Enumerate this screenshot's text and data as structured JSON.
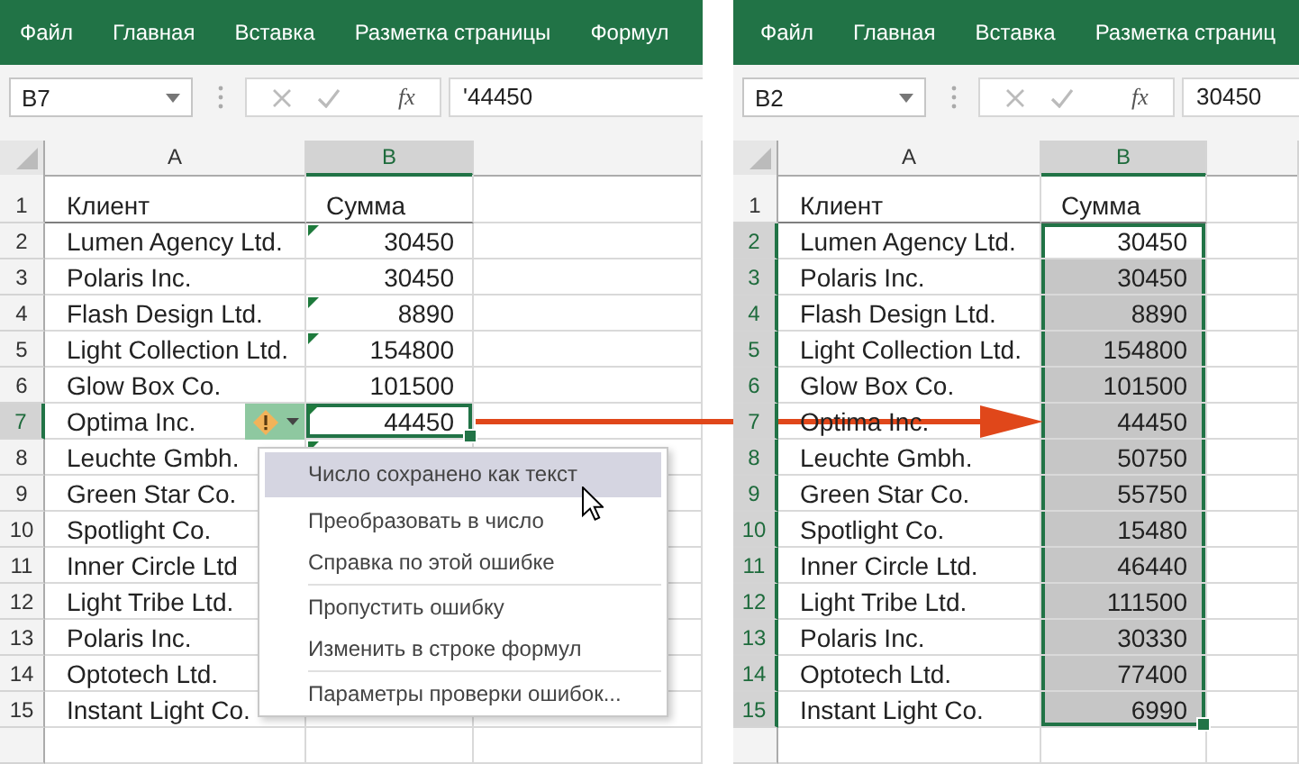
{
  "panels": [
    {
      "ribbon_tabs": [
        "Файл",
        "Главная",
        "Вставка",
        "Разметка страницы",
        "Формул"
      ],
      "name_box": "B7",
      "formula_button": "fx",
      "formula": "'44450",
      "columns": [
        {
          "label": "A",
          "selected": false
        },
        {
          "label": "B",
          "selected": true
        }
      ],
      "rows": [
        {
          "number": "1",
          "kind": "heading",
          "client": "Клиент",
          "amount": "Сумма",
          "header_selected": false,
          "amount_selected": false,
          "active": false,
          "error_mark": false,
          "error_button": false
        },
        {
          "number": "2",
          "kind": "data",
          "client": "Lumen Agency Ltd.",
          "amount": "30450",
          "header_selected": false,
          "amount_selected": false,
          "active": false,
          "error_mark": true,
          "error_button": false
        },
        {
          "number": "3",
          "kind": "data",
          "client": "Polaris Inc.",
          "amount": "30450",
          "header_selected": false,
          "amount_selected": false,
          "active": false,
          "error_mark": false,
          "error_button": false
        },
        {
          "number": "4",
          "kind": "data",
          "client": "Flash Design Ltd.",
          "amount": "8890",
          "header_selected": false,
          "amount_selected": false,
          "active": false,
          "error_mark": true,
          "error_button": false
        },
        {
          "number": "5",
          "kind": "data",
          "client": "Light Collection Ltd.",
          "amount": "154800",
          "header_selected": false,
          "amount_selected": false,
          "active": false,
          "error_mark": true,
          "error_button": false
        },
        {
          "number": "6",
          "kind": "data",
          "client": "Glow Box Co.",
          "amount": "101500",
          "header_selected": false,
          "amount_selected": false,
          "active": false,
          "error_mark": false,
          "error_button": false
        },
        {
          "number": "7",
          "kind": "data",
          "client": "Optima Inc.",
          "amount": "44450",
          "header_selected": true,
          "amount_selected": false,
          "active": true,
          "error_mark": true,
          "error_button": true
        },
        {
          "number": "8",
          "kind": "data",
          "client": "Leuchte Gmbh.",
          "header_selected": false,
          "error_mark": true,
          "error_button": false
        },
        {
          "number": "9",
          "kind": "data",
          "client": "Green Star Co.",
          "header_selected": false,
          "error_button": false
        },
        {
          "number": "10",
          "kind": "data",
          "client": "Spotlight Co.",
          "header_selected": false,
          "error_button": false
        },
        {
          "number": "11",
          "kind": "data",
          "client": "Inner Circle Ltd",
          "header_selected": false,
          "error_button": false
        },
        {
          "number": "12",
          "kind": "data",
          "client": "Light Tribe Ltd.",
          "header_selected": false,
          "error_button": false
        },
        {
          "number": "13",
          "kind": "data",
          "client": "Polaris Inc.",
          "header_selected": false,
          "error_button": false
        },
        {
          "number": "14",
          "kind": "data",
          "client": "Optotech Ltd.",
          "header_selected": false,
          "error_button": false
        },
        {
          "number": "15",
          "kind": "data",
          "client": "Instant Light Co.",
          "header_selected": false,
          "error_button": false
        }
      ],
      "error_menu": {
        "items": [
          {
            "label": "Число сохранено как текст",
            "selected": true,
            "divider_before": false
          },
          {
            "label": "Преобразовать в число",
            "selected": false,
            "divider_before": false
          },
          {
            "label": "Справка по этой ошибке",
            "selected": false,
            "divider_before": false
          },
          {
            "label": "Пропустить ошибку",
            "selected": false,
            "divider_before": true
          },
          {
            "label": "Изменить в строке формул",
            "selected": false,
            "divider_before": false
          },
          {
            "label": "Параметры проверки ошибок...",
            "selected": false,
            "divider_before": true
          }
        ]
      }
    },
    {
      "ribbon_tabs": [
        "Файл",
        "Главная",
        "Вставка",
        "Разметка страниц"
      ],
      "name_box": "B2",
      "formula_button": "fx",
      "formula": "30450",
      "columns": [
        {
          "label": "A",
          "selected": false
        },
        {
          "label": "B",
          "selected": true
        }
      ],
      "rows": [
        {
          "number": "1",
          "kind": "heading",
          "client": "Клиент",
          "amount": "Сумма",
          "header_selected": false,
          "amount_selected": false,
          "active": false,
          "error_mark": false,
          "error_button": false
        },
        {
          "number": "2",
          "kind": "data",
          "client": "Lumen Agency Ltd.",
          "amount": "30450",
          "header_selected": true,
          "amount_selected": false,
          "active": true,
          "error_mark": false,
          "error_button": false
        },
        {
          "number": "3",
          "kind": "data",
          "client": "Polaris Inc.",
          "amount": "30450",
          "header_selected": true,
          "amount_selected": true,
          "active": false,
          "error_mark": false,
          "error_button": false
        },
        {
          "number": "4",
          "kind": "data",
          "client": "Flash Design Ltd.",
          "amount": "8890",
          "header_selected": true,
          "amount_selected": true,
          "active": false,
          "error_mark": false,
          "error_button": false
        },
        {
          "number": "5",
          "kind": "data",
          "client": "Light Collection Ltd.",
          "amount": "154800",
          "header_selected": true,
          "amount_selected": true,
          "active": false,
          "error_mark": false,
          "error_button": false
        },
        {
          "number": "6",
          "kind": "data",
          "client": "Glow Box Co.",
          "amount": "101500",
          "header_selected": true,
          "amount_selected": true,
          "active": false,
          "error_mark": false,
          "error_button": false
        },
        {
          "number": "7",
          "kind": "data",
          "client": "Optima Inc.",
          "amount": "44450",
          "header_selected": true,
          "amount_selected": true,
          "active": false,
          "error_mark": false,
          "error_button": false
        },
        {
          "number": "8",
          "kind": "data",
          "client": "Leuchte Gmbh.",
          "amount": "50750",
          "header_selected": true,
          "amount_selected": true,
          "active": false,
          "error_mark": false,
          "error_button": false
        },
        {
          "number": "9",
          "kind": "data",
          "client": "Green Star Co.",
          "amount": "55750",
          "header_selected": true,
          "amount_selected": true,
          "active": false,
          "error_mark": false,
          "error_button": false
        },
        {
          "number": "10",
          "kind": "data",
          "client": "Spotlight Co.",
          "amount": "15480",
          "header_selected": true,
          "amount_selected": true,
          "active": false,
          "error_mark": false,
          "error_button": false
        },
        {
          "number": "11",
          "kind": "data",
          "client": "Inner Circle Ltd.",
          "amount": "46440",
          "header_selected": true,
          "amount_selected": true,
          "active": false,
          "error_mark": false,
          "error_button": false
        },
        {
          "number": "12",
          "kind": "data",
          "client": "Light Tribe Ltd.",
          "amount": "111500",
          "header_selected": true,
          "amount_selected": true,
          "active": false,
          "error_mark": false,
          "error_button": false
        },
        {
          "number": "13",
          "kind": "data",
          "client": "Polaris Inc.",
          "amount": "30330",
          "header_selected": true,
          "amount_selected": true,
          "active": false,
          "error_mark": false,
          "error_button": false
        },
        {
          "number": "14",
          "kind": "data",
          "client": "Optotech Ltd.",
          "amount": "77400",
          "header_selected": true,
          "amount_selected": true,
          "active": false,
          "error_mark": false,
          "error_button": false
        },
        {
          "number": "15",
          "kind": "data",
          "client": "Instant Light Co.",
          "amount": "6990",
          "header_selected": true,
          "amount_selected": true,
          "active": false,
          "error_mark": false,
          "error_button": false
        }
      ]
    }
  ]
}
